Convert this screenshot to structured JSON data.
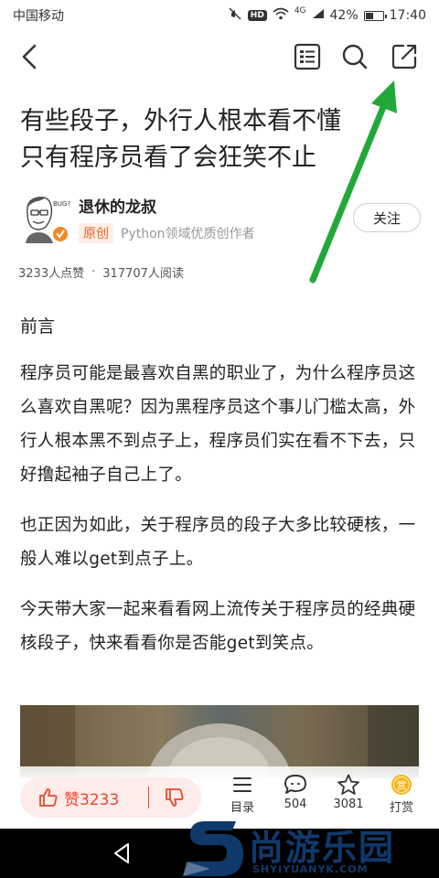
{
  "status": {
    "carrier": "中国移动",
    "signal_tag": "4G",
    "battery": "42%",
    "time": "17:40"
  },
  "nav": {
    "back": "back-icon",
    "toc": "list-icon",
    "search": "search-icon",
    "share": "share-icon"
  },
  "article": {
    "title_line1": "有些段子，外行人根本看不懂",
    "title_line2": "只有程序员看了会狂笑不止",
    "author": {
      "name": "退休的龙叔",
      "tag": "原创",
      "desc": "Python领域优质创作者",
      "follow": "关注",
      "avatar_caption": "BUG?"
    },
    "stats": {
      "likes": "3233人点赞",
      "sep": "·",
      "reads": "317707人阅读"
    },
    "heading": "前言",
    "paragraphs": [
      "程序员可能是最喜欢自黑的职业了，为什么程序员这么喜欢自黑呢？因为黑程序员这个事儿门槛太高，外行人根本黑不到点子上，程序员们实在看不下去，只好撸起袖子自己上了。",
      "也正因为如此，关于程序员的段子大多比较硬核，一般人难以get到点子上。",
      "今天带大家一起来看看网上流传关于程序员的经典硬核段子，快来看看你是否能get到笑点。"
    ]
  },
  "bottom": {
    "like_label": "赞3233",
    "toc_label": "目录",
    "comments": "504",
    "favorites": "3081",
    "reward": "打赏",
    "reward_glyph": "赏"
  },
  "watermark": {
    "text": "尚游乐园",
    "url": "SHYIYUANYK.COM"
  },
  "colors": {
    "accent": "#e8472c",
    "annotation_arrow": "#22a83a",
    "brand": "#10396b"
  }
}
